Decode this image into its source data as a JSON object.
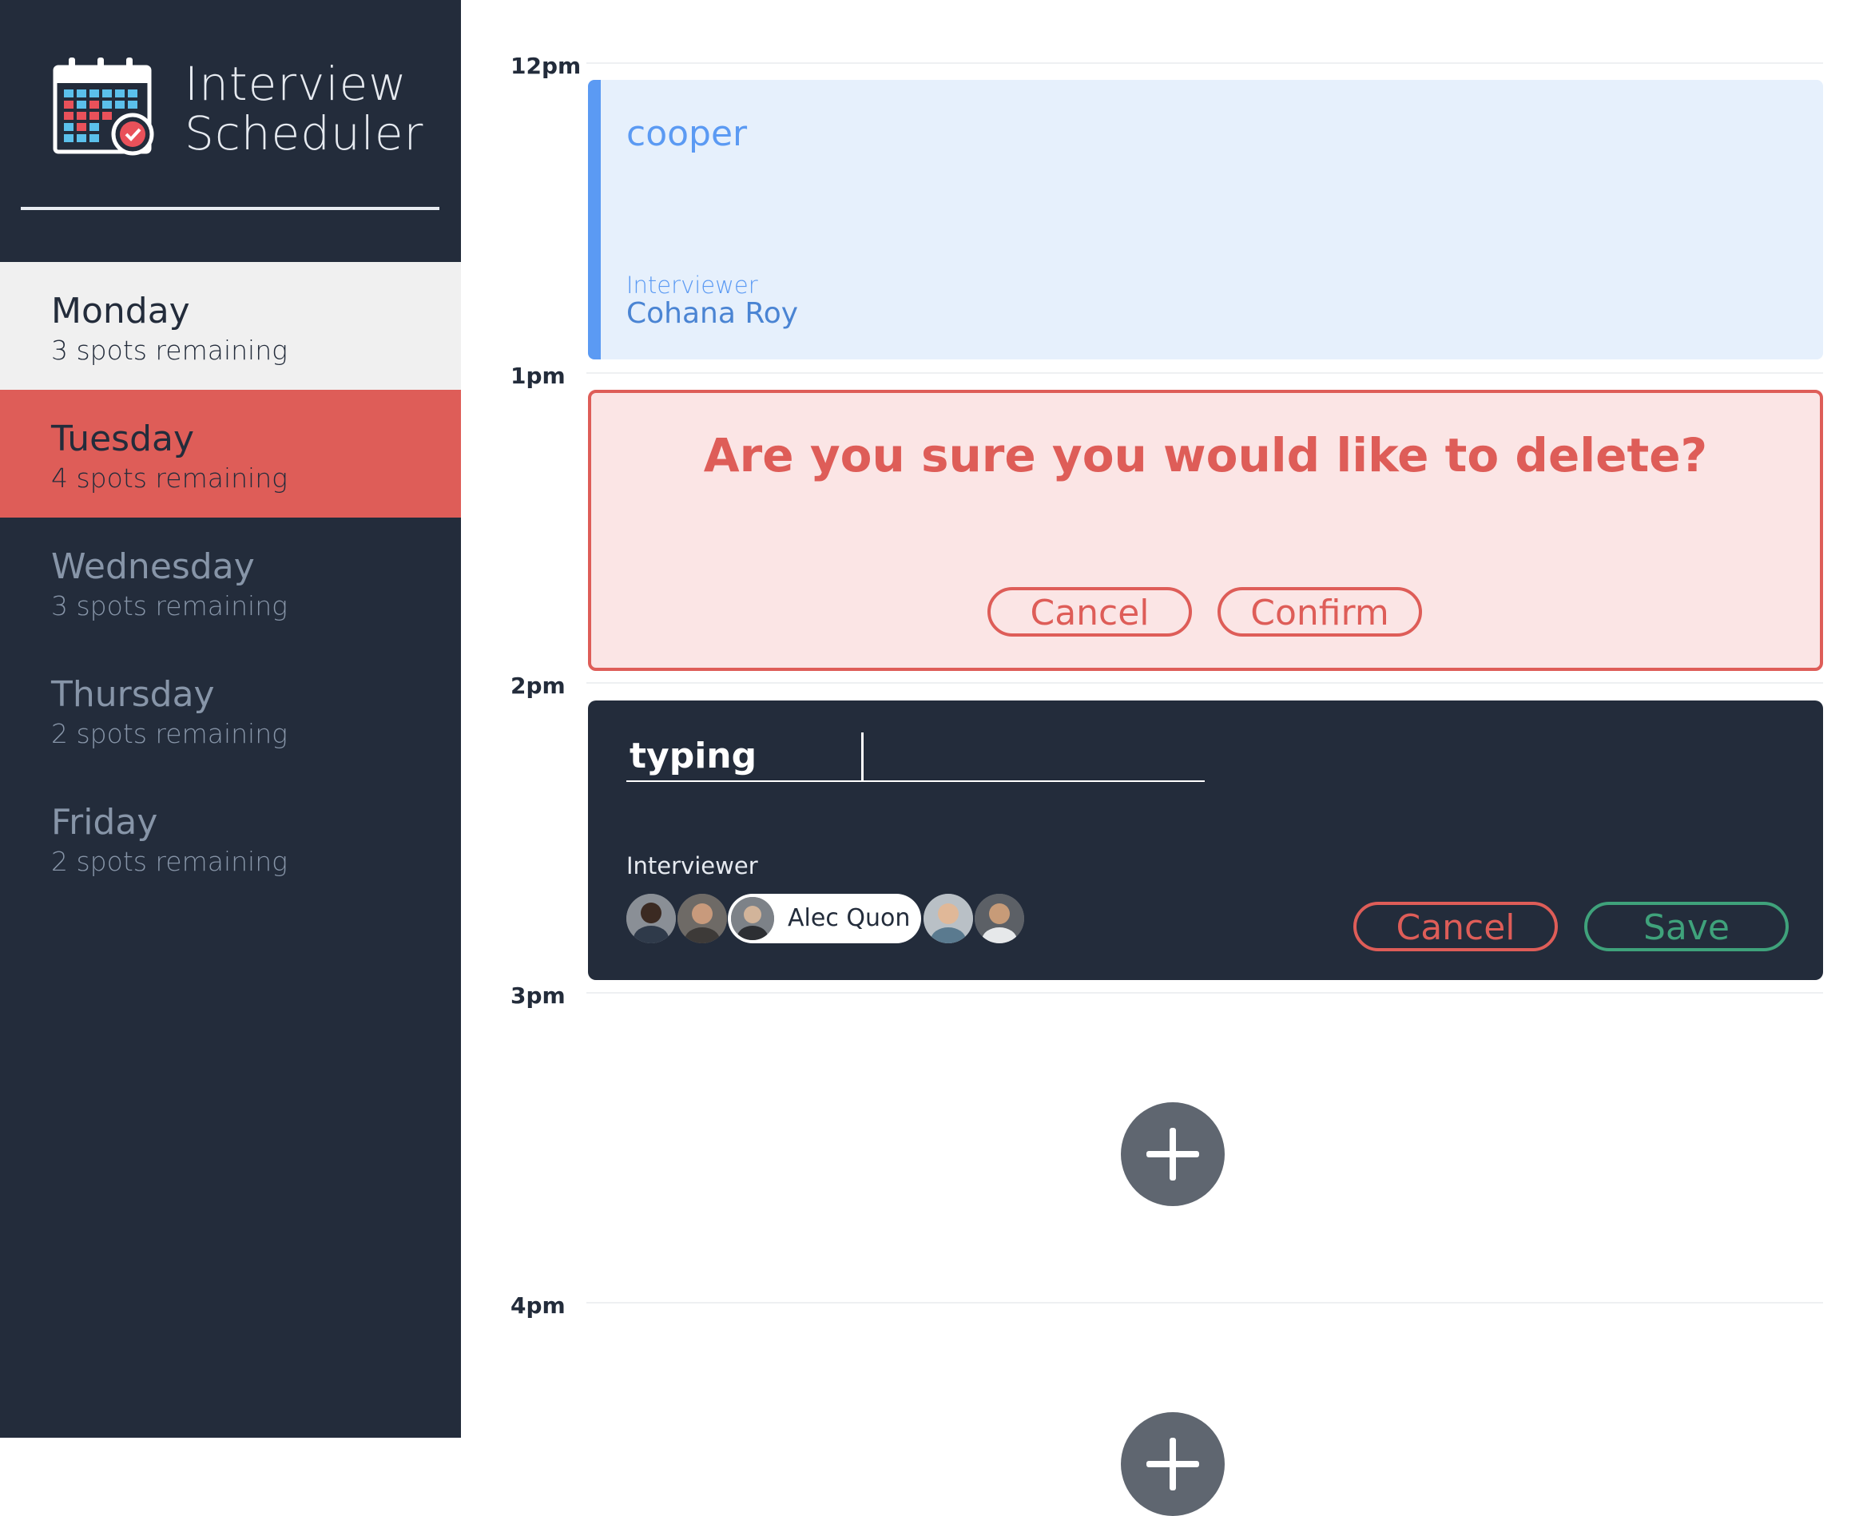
{
  "app": {
    "title_line1": "Interview",
    "title_line2": "Scheduler"
  },
  "days": [
    {
      "name": "Monday",
      "spots": "3 spots remaining"
    },
    {
      "name": "Tuesday",
      "spots": "4 spots remaining"
    },
    {
      "name": "Wednesday",
      "spots": "3 spots remaining"
    },
    {
      "name": "Thursday",
      "spots": "2 spots remaining"
    },
    {
      "name": "Friday",
      "spots": "2 spots remaining"
    }
  ],
  "times": [
    "12pm",
    "1pm",
    "2pm",
    "3pm",
    "4pm"
  ],
  "appointments": {
    "show": {
      "student": "cooper",
      "interviewer_label": "Interviewer",
      "interviewer_name": "Cohana Roy"
    },
    "confirm": {
      "message": "Are you sure you would like to delete?",
      "cancel_label": "Cancel",
      "confirm_label": "Confirm"
    },
    "form": {
      "student_value": "typing",
      "interviewer_label": "Interviewer",
      "selected_interviewer": "Alec Quon",
      "cancel_label": "Cancel",
      "save_label": "Save"
    }
  },
  "colors": {
    "sidebar_bg": "#232c3b",
    "selected_day_bg": "#f0f0f0",
    "active_day_bg": "#de5d58",
    "show_accent": "#5b9af3",
    "danger": "#de5d58",
    "success": "#3fa27b"
  }
}
